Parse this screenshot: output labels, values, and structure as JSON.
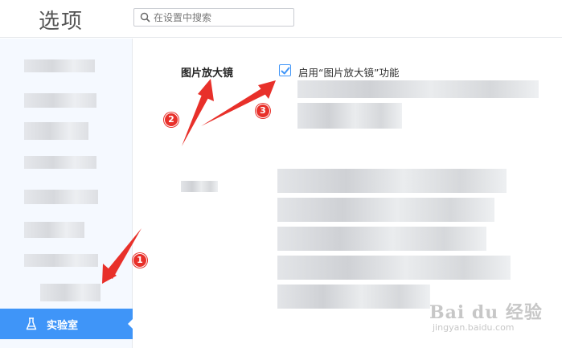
{
  "header": {
    "title": "选项",
    "search_placeholder": "在设置中搜索"
  },
  "sidebar": {
    "active_item": {
      "label": "实验室",
      "icon": "flask-icon"
    }
  },
  "setting": {
    "section_label": "图片放大镜",
    "checkbox_label": "启用“图片放大镜”功能",
    "checkbox_checked": true
  },
  "annotations": {
    "step_1": "1",
    "step_2": "2",
    "step_3": "3",
    "color": "#e8302a"
  },
  "watermark": {
    "main": "Bai du 经验",
    "sub": "jingyan.baidu.com"
  },
  "colors": {
    "accent": "#3f95f8",
    "sidebar_bg": "#f5f9ff"
  }
}
